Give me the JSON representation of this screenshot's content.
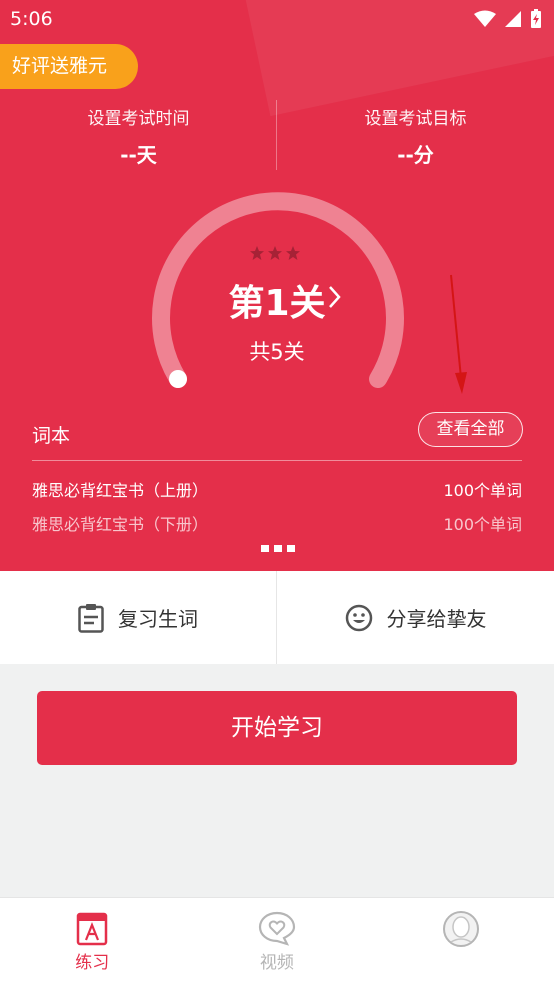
{
  "status_bar": {
    "time": "5:06"
  },
  "promo": {
    "label": "好评送雅元"
  },
  "exam": {
    "time": {
      "label": "设置考试时间",
      "value": "--天"
    },
    "target": {
      "label": "设置考试目标",
      "value": "--分"
    }
  },
  "level": {
    "title": "第1关",
    "total": "共5关",
    "stars_earned": 0,
    "stars_total": 3
  },
  "wordbook": {
    "title": "词本",
    "view_all": "查看全部",
    "books": [
      {
        "name": "雅思必背红宝书（上册）",
        "count": "100个单词"
      },
      {
        "name": "雅思必背红宝书（下册）",
        "count": "100个单词"
      }
    ],
    "page_dots": 3
  },
  "actions": {
    "review": "复习生词",
    "share": "分享给挚友"
  },
  "start_button": "开始学习",
  "tabs": [
    {
      "label": "练习",
      "icon": "book-a-icon",
      "active": true
    },
    {
      "label": "视频",
      "icon": "heart-bubble-icon",
      "active": false
    },
    {
      "label": "",
      "icon": "avatar-icon",
      "active": false
    }
  ],
  "colors": {
    "primary": "#e42f4a",
    "promo": "#f9a11b",
    "annotation_arrow": "#d41515"
  }
}
